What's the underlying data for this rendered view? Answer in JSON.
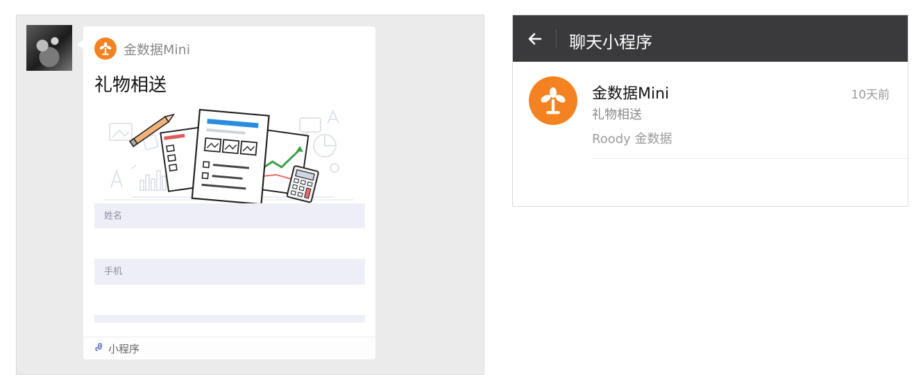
{
  "chat": {
    "card": {
      "app_name": "金数据Mini",
      "title": "礼物相送",
      "fields": [
        {
          "label": "姓名"
        },
        {
          "label": "手机"
        }
      ],
      "footer_label": "小程序"
    }
  },
  "panel": {
    "title": "聊天小程序",
    "item": {
      "name": "金数据Mini",
      "subtitle": "礼物相送",
      "user": "Roody 金数据",
      "time": "10天前"
    }
  },
  "colors": {
    "brand_orange": "#f58220",
    "topbar_bg": "#3a3a3c",
    "chat_bg": "#ebebeb"
  },
  "icons": [
    "back-arrow-icon",
    "mini-program-icon",
    "logo-icon",
    "document-illustration"
  ]
}
